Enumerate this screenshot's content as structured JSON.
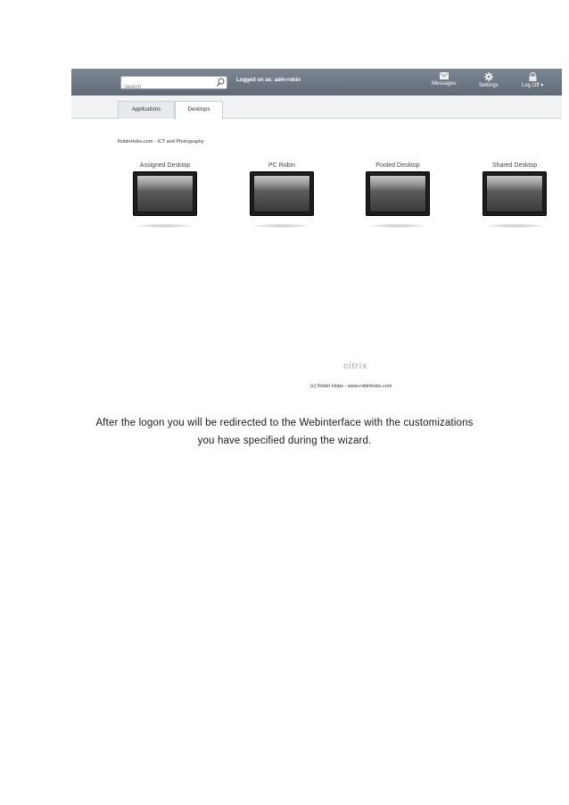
{
  "topbar": {
    "search_placeholder": "Search",
    "logged_on": "Logged on as: adm-robin",
    "messages_label": "Messages",
    "settings_label": "Settings",
    "logoff_label": "Log Off ▾"
  },
  "tabs": [
    {
      "label": "Applications",
      "active": false
    },
    {
      "label": "Desktops",
      "active": true
    }
  ],
  "site_title": "RobinHobo.com - ICT and Photography",
  "desktops": [
    {
      "label": "Assigned Desktop"
    },
    {
      "label": "PC Robin"
    },
    {
      "label": "Pooled Desktop"
    },
    {
      "label": "Shared Desktop"
    }
  ],
  "citrix_logo": "citrix",
  "copyright": "(c) Robin Hobo - www.robinhobo.com",
  "caption": {
    "line1": "After the logon you will be redirected to the Webinterface with the customizations",
    "line2": "you have specified during the wizard."
  },
  "colors": {
    "topbar": "#6f7a85",
    "tabstrip": "#f0f2f4"
  }
}
